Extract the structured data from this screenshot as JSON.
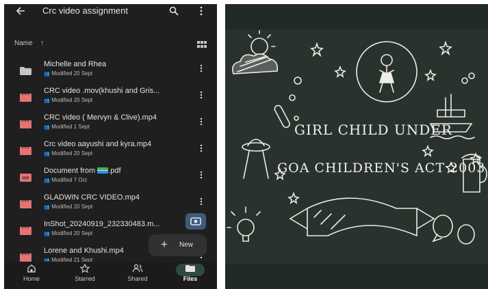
{
  "drive": {
    "title": "Crc video assignment",
    "sort_label": "Name",
    "sort_arrow": "↑",
    "files": [
      {
        "name": "Michelle and Rhea",
        "modified": "Modified 20 Sept",
        "type": "folder"
      },
      {
        "name": "CRC video .mov(khushi and Gris...",
        "modified": "Modified 20 Sept",
        "type": "video"
      },
      {
        "name": "CRC video ( Mervyn & Clive).mp4",
        "modified": "Modified 1 Sept",
        "type": "video"
      },
      {
        "name": "Crc video aayushi and kyra.mp4",
        "modified": "Modified 20 Sept",
        "type": "video"
      },
      {
        "name_before": "Document from ",
        "name_after": ".pdf",
        "modified": "Modified 7 Oct",
        "type": "pdf"
      },
      {
        "name": "GLADWIN CRC VIDEO.mp4",
        "modified": "Modified 20 Sept",
        "type": "video"
      },
      {
        "name": "InShot_20240919_232330483.m...",
        "modified": "Modified 20 Sept",
        "type": "video"
      },
      {
        "name": "Lorene and Khushi.mp4",
        "modified": "Modified 21 Sept",
        "type": "video"
      }
    ],
    "new_label": "New",
    "nav": [
      {
        "label": "Home",
        "icon": "home-icon"
      },
      {
        "label": "Starred",
        "icon": "star-icon"
      },
      {
        "label": "Shared",
        "icon": "shared-icon"
      },
      {
        "label": "Files",
        "icon": "folder-icon"
      }
    ],
    "colors": {
      "background": "#1f1f1f",
      "video_icon": "#e57373",
      "pdf_icon": "#e57373",
      "folder_icon": "#c4c7c5",
      "active_nav": "#2f4a3a"
    }
  },
  "board": {
    "title_line1": "GIRL CHILD UNDER",
    "title_line2": "GOA CHILDREN'S ACT 2003",
    "colors": {
      "chalkboard": "#222a26",
      "chalk": "#f1f1ee"
    }
  }
}
